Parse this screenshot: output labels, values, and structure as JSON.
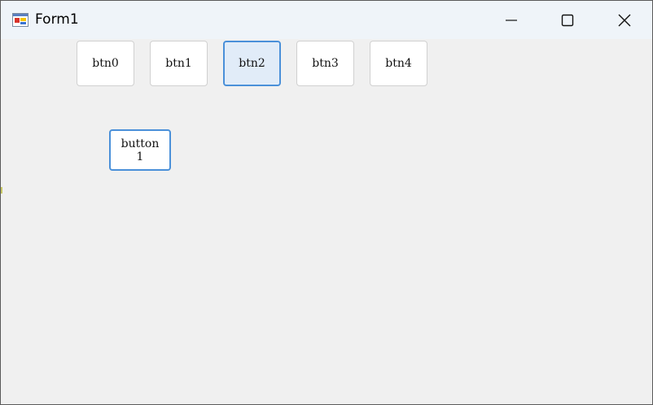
{
  "window": {
    "title": "Form1",
    "icon": "winforms-app-icon",
    "controls": {
      "minimize_icon": "minimize-icon",
      "maximize_icon": "maximize-icon",
      "close_icon": "close-icon"
    }
  },
  "buttons": [
    {
      "label": "btn0"
    },
    {
      "label": "btn1"
    },
    {
      "label": "btn2"
    },
    {
      "label": "btn3"
    },
    {
      "label": "btn4"
    }
  ],
  "main_button": {
    "label": "button\n1"
  },
  "colors": {
    "titlebar": "#eff4f9",
    "client": "#f0f0f0",
    "accent_border": "#4a90d9",
    "active_fill": "#e1ecf8"
  }
}
